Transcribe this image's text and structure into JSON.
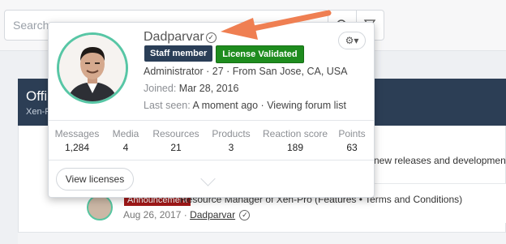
{
  "search": {
    "placeholder": "Search"
  },
  "background": {
    "panel_title": "Offi",
    "panel_sub": "Xen-F",
    "desc_snippet": "new releases and development",
    "thread": {
      "badge": "Announcement",
      "title": "Resource Manager of Xen-Pro (Features • Terms and Conditions)",
      "date": "Aug 26, 2017",
      "author": "Dadparvar"
    }
  },
  "card": {
    "name": "Dadparvar",
    "badges": [
      "Staff member",
      "License Validated"
    ],
    "role_line": "Administrator · 27 · From San Jose, CA, USA",
    "joined_label": "Joined:",
    "joined_value": "Mar 28, 2016",
    "last_seen_label": "Last seen:",
    "last_seen_value": "A moment ago · Viewing forum list",
    "stats": [
      {
        "label": "Messages",
        "value": "1,284"
      },
      {
        "label": "Media",
        "value": "4"
      },
      {
        "label": "Resources",
        "value": "21"
      },
      {
        "label": "Products",
        "value": "3"
      },
      {
        "label": "Reaction score",
        "value": "189"
      },
      {
        "label": "Points",
        "value": "63"
      }
    ],
    "view_button": "View licenses"
  },
  "icons": [
    "search-icon",
    "filter-icon",
    "verified-icon",
    "gear-icon",
    "caret-down-icon"
  ],
  "colors": {
    "accent_ring": "#57c6a5",
    "staff": "#2a3e57",
    "license": "#1e8c1e",
    "arrow": "#ef7f52"
  }
}
